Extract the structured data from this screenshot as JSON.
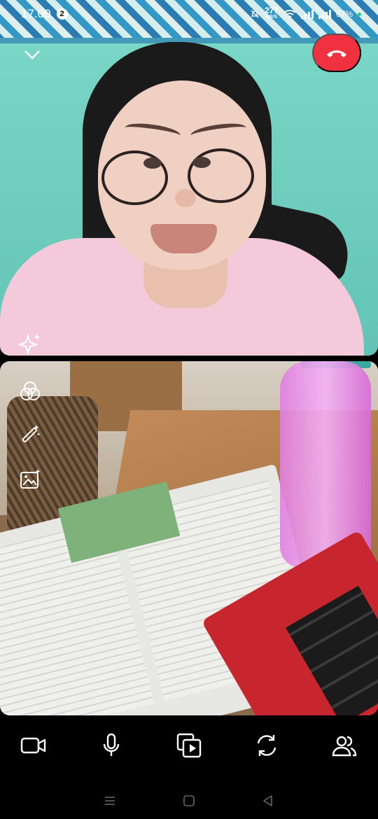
{
  "status_bar": {
    "time": "17.00",
    "notification_count": "2",
    "net_speed_value": "277",
    "net_speed_unit": "KB/S",
    "battery": "67%"
  },
  "icons": {
    "collapse": "chevron-down-icon",
    "end_call": "phone-hangup-icon",
    "effects": "sparkles-icon",
    "filters": "color-circles-icon",
    "retouch": "magic-wand-icon",
    "background": "image-sparkle-icon",
    "camera": "video-camera-icon",
    "mic": "microphone-icon",
    "share_media": "media-share-icon",
    "switch_camera": "switch-camera-icon",
    "participants": "people-icon",
    "nav_menu": "menu-icon",
    "nav_home": "home-square-icon",
    "nav_back": "back-triangle-icon"
  },
  "colors": {
    "end_call": "#f0313f",
    "background": "#000000"
  }
}
